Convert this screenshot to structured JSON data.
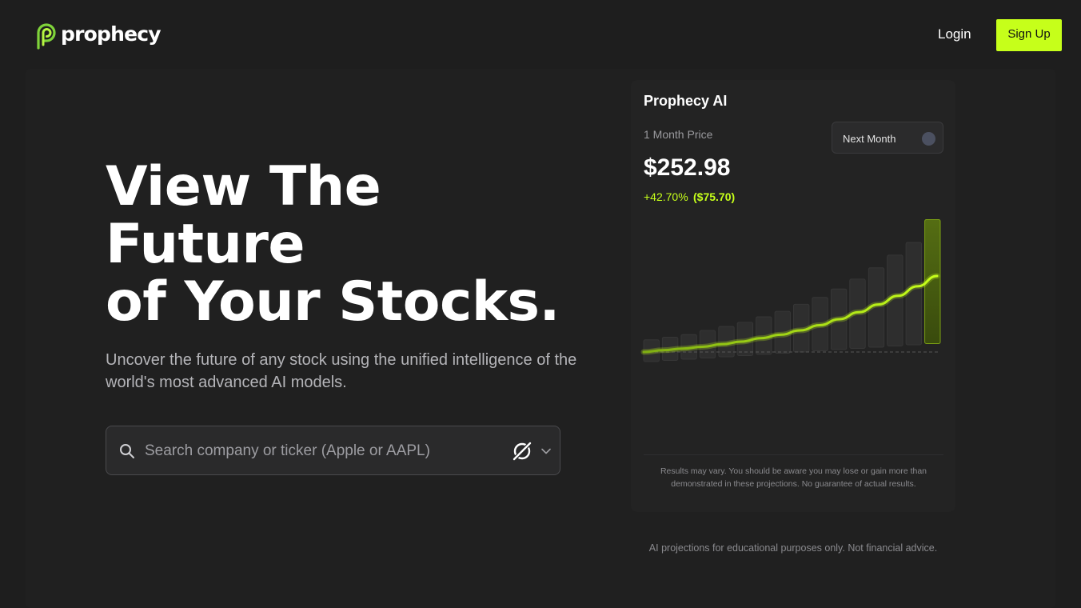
{
  "header": {
    "brand": "prophecy",
    "login_label": "Login",
    "signup_label": "Sign Up"
  },
  "hero": {
    "title_lines": [
      "View The",
      "Future",
      "of Your Stocks."
    ],
    "subtitle": "Uncover the future of any stock using the unified intelligence of the world's most advanced AI models."
  },
  "search": {
    "placeholder": "Search company or ticker (Apple or AAPL)",
    "value": ""
  },
  "card": {
    "title": "Prophecy AI",
    "label": "1 Month Price",
    "toggle_label": "Next Month",
    "toggle_on": false,
    "price": "$252.98",
    "change_pct": "+42.70%",
    "change_amt": "($75.70)",
    "disclaimer": "Results may vary. You should be aware you may lose or gain more than demonstrated in these projections. No guarantee of actual results."
  },
  "footnote": "AI projections for educational purposes only. Not financial advice.",
  "colors": {
    "accent": "#c6ff1a",
    "background": "#1e1e1e",
    "panel": "#202020",
    "card": "#232323",
    "muted_text": "#9a9a9e"
  },
  "icons": {
    "search": "search-icon",
    "model": "ai-model-icon",
    "dropdown": "chevron-down-icon",
    "logo": "prophecy-logo-icon"
  },
  "chart_data": {
    "type": "area",
    "title": "",
    "xlabel": "",
    "ylabel": "",
    "bar_count": 16,
    "bars_relative_height": [
      0.04,
      0.05,
      0.06,
      0.08,
      0.1,
      0.12,
      0.15,
      0.18,
      0.22,
      0.26,
      0.31,
      0.37,
      0.44,
      0.52,
      0.6,
      0.75
    ],
    "projection_curve": [
      0.0,
      0.02,
      0.04,
      0.06,
      0.09,
      0.12,
      0.16,
      0.2,
      0.25,
      0.31,
      0.38,
      0.46,
      0.55,
      0.65,
      0.76,
      0.88
    ],
    "baseline_dashed": true,
    "start_value": 177.28,
    "end_value": 252.98
  }
}
